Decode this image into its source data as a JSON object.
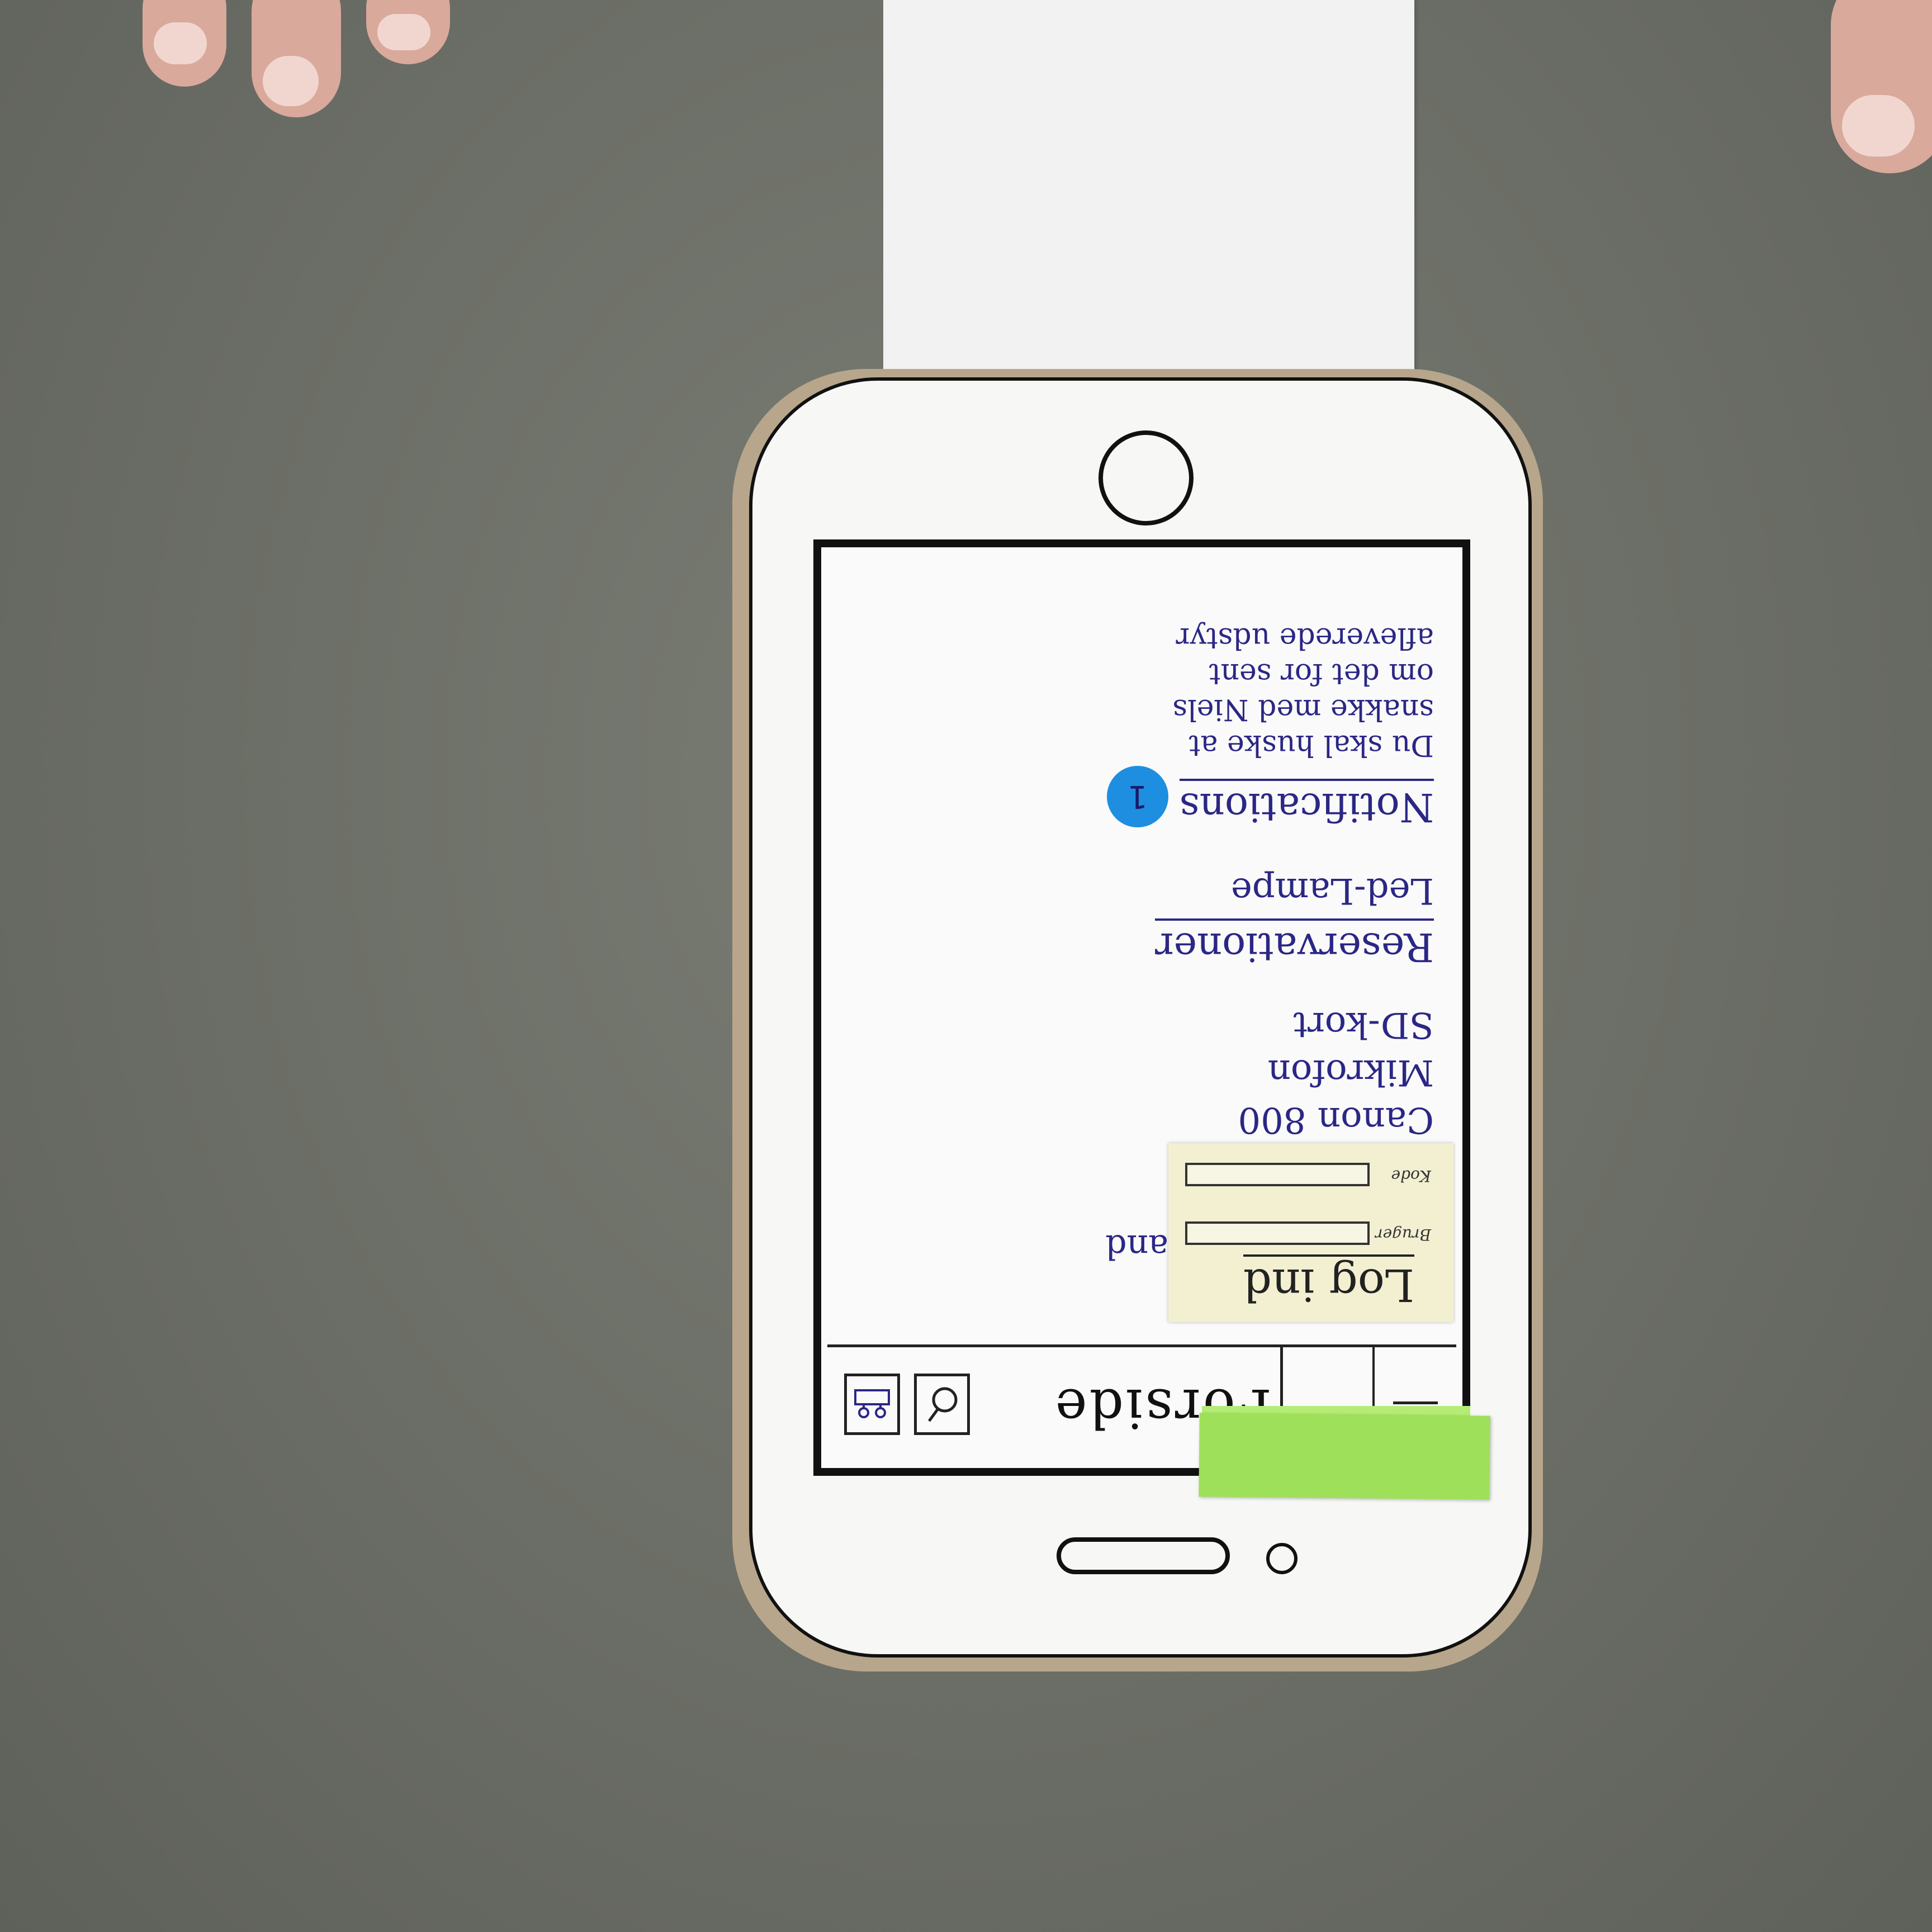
{
  "app": {
    "title": "Forside",
    "menu_icon": "hamburger-icon",
    "search_icon": "search-icon",
    "user_icon": "user-icon"
  },
  "login": {
    "title": "Log ind",
    "username_label": "Bruger",
    "password_label": "Kode"
  },
  "equipment": {
    "items": [
      "Canon 800",
      "Mikrofon",
      "SD-kort"
    ],
    "partial_above": "and"
  },
  "reservations": {
    "heading": "Reservationer",
    "items": [
      "Led-Lampe"
    ]
  },
  "notifications": {
    "heading": "Notifications",
    "count": "1",
    "message_lines": [
      "Du skal huske at",
      "snakke med Niels",
      "om det for sent",
      "afleverede udstyr"
    ]
  },
  "colors": {
    "ink": "#2b2785",
    "badge": "#1e8fe0",
    "sticky_yellow": "#f3f0d2",
    "sticky_green": "#9fe05a",
    "table": "#6b6e66"
  }
}
